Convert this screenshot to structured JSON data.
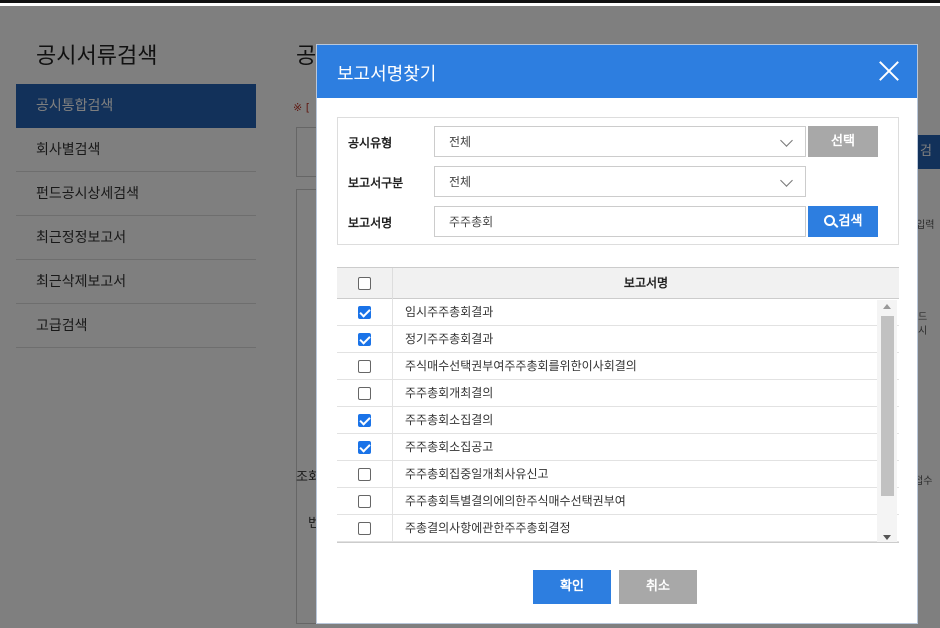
{
  "background": {
    "app_title": "공시서류검색",
    "content_title": "공시통합검색",
    "note": "※ [",
    "nav": [
      {
        "label": "공시통합검색",
        "active": true
      },
      {
        "label": "회사별검색",
        "active": false
      },
      {
        "label": "펀드공시상세검색",
        "active": false
      },
      {
        "label": "최근정정보고서",
        "active": false
      },
      {
        "label": "최근삭제보고서",
        "active": false
      },
      {
        "label": "고급검색",
        "active": false
      }
    ],
    "partial_labels": [
      "조회",
      "번"
    ],
    "right_button": "검",
    "right_texts": [
      "입력",
      "드",
      "시",
      "접수"
    ]
  },
  "modal": {
    "title": "보고서명찾기",
    "form": {
      "type_label": "공시유형",
      "type_value": "전체",
      "select_button": "선택",
      "category_label": "보고서구분",
      "category_value": "전체",
      "name_label": "보고서명",
      "name_value": "주주총회",
      "search_button": "검색"
    },
    "table": {
      "header": "보고서명",
      "rows": [
        {
          "name": "임시주주총회결과",
          "checked": true
        },
        {
          "name": "정기주주총회결과",
          "checked": true
        },
        {
          "name": "주식매수선택권부여주주총회를위한이사회결의",
          "checked": false
        },
        {
          "name": "주주총회개최결의",
          "checked": false
        },
        {
          "name": "주주총회소집결의",
          "checked": true
        },
        {
          "name": "주주총회소집공고",
          "checked": true
        },
        {
          "name": "주주총회집중일개최사유신고",
          "checked": false
        },
        {
          "name": "주주총회특별결의에의한주식매수선택권부여",
          "checked": false
        },
        {
          "name": "주총결의사항에관한주주총회결정",
          "checked": false
        }
      ]
    },
    "confirm_button": "확인",
    "cancel_button": "취소"
  },
  "colors": {
    "primary": "#2d7ee0",
    "nav_active": "#2463b4",
    "gray_button": "#a8a8a8"
  }
}
